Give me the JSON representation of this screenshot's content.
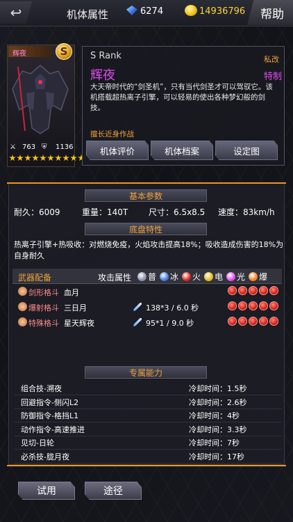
{
  "header": {
    "title": "机体属性",
    "gems": "6274",
    "coins": "14936796",
    "help_label": "帮助",
    "back_icon": "back-arrow-icon"
  },
  "mech": {
    "portrait_name": "辉夜",
    "rank_badge": "S",
    "attack": "763",
    "defense": "1136",
    "stars": 10,
    "rank_label": "S Rank",
    "name": "辉夜",
    "tag_private": "私改",
    "tag_special": "特制",
    "description": "大天帝时代的“剑圣机”，只有当代剑圣才可以驾驭它。该机搭载超热离子引擎，可以轻易的使出各种梦幻般的剑技。",
    "specialty": "擅长近身作战",
    "buttons": [
      "机体评价",
      "机体档案",
      "设定图"
    ]
  },
  "basic": {
    "header": "基本参数",
    "durability": "耐久：6009",
    "weight": "重量：140T",
    "size": "尺寸：6.5x8.5",
    "speed": "速度：83km/h"
  },
  "chassis": {
    "header": "底盘特性",
    "text": "热离子引擎+热吸收：对燃烧免疫，火焰攻击提高18%；吸收造成伤害的18%为自身耐久"
  },
  "weapons": {
    "header": "武器配备",
    "attr_label": "攻击属性",
    "elements": [
      {
        "label": "普",
        "color": "#8a8fa8"
      },
      {
        "label": "冰",
        "color": "#3f7be8"
      },
      {
        "label": "火",
        "color": "#d8281a"
      },
      {
        "label": "电",
        "color": "#e8b51a"
      },
      {
        "label": "光",
        "color": "#e04cf0"
      },
      {
        "label": "爆",
        "color": "#f0821e"
      }
    ],
    "rows": [
      {
        "type": "剑形格斗",
        "name": "血月",
        "stat": "",
        "dots": 5
      },
      {
        "type": "爆射格斗",
        "name": "三日月",
        "stat": "138*3 / 6.0 秒",
        "dots": 5
      },
      {
        "type": "特殊格斗",
        "name": "星天辉夜",
        "stat": "95*1 / 9.0 秒",
        "dots": 5
      }
    ]
  },
  "abilities": {
    "header": "专属能力",
    "rows": [
      {
        "name": "组合技-溯夜",
        "cooldown": "冷却时间：1.5秒"
      },
      {
        "name": "回避指令-侧闪L2",
        "cooldown": "冷却时间：2.6秒"
      },
      {
        "name": "防御指令-格挡L1",
        "cooldown": "冷却时间：4秒"
      },
      {
        "name": "动作指令-高速推进",
        "cooldown": "冷却时间：3.3秒"
      },
      {
        "name": "见切-日轮",
        "cooldown": "冷却时间：7秒"
      },
      {
        "name": "必杀技-胧月夜",
        "cooldown": "冷却时间：17秒"
      }
    ]
  },
  "footer": {
    "trial": "试用",
    "source": "途径"
  }
}
